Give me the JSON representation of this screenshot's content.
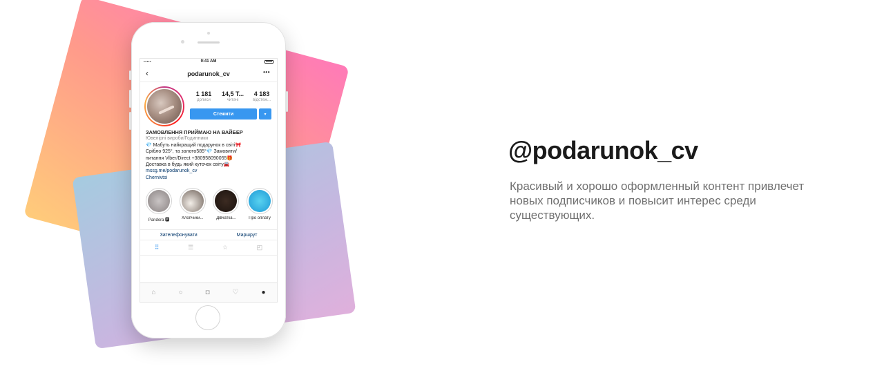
{
  "phone": {
    "status_bar": {
      "signal": "•••••",
      "time": "9:41 AM"
    },
    "nav": {
      "back_icon": "‹",
      "username": "podarunok_cv",
      "more_icon": "•••"
    },
    "stats": [
      {
        "value": "1 181",
        "label": "дописи"
      },
      {
        "value": "14,5 Т...",
        "label": "читачі"
      },
      {
        "value": "4 183",
        "label": "відстеж..."
      }
    ],
    "follow_label": "Стежити",
    "dropdown_icon": "▾",
    "bio": {
      "name": "ЗАМОВЛЕННЯ ПРИЙМАЮ НА ВАЙБЕР",
      "category": "Ювелірні вироби/Годинники",
      "lines": [
        "💎 Мабуть найкращий подарунок в світі🎀",
        "Срібло 925°, та золото585°💎 Замовити/",
        "питання Viber/Direct +380958090055🎁",
        "Доставка в будь який куточок світу🚘"
      ],
      "link": "mssg.me/podarunok_cv",
      "location": "Chernivtsi"
    },
    "highlights": [
      {
        "label": "Pandora 🅿"
      },
      {
        "label": "Хлопчики..."
      },
      {
        "label": "Дівчатка..."
      },
      {
        "label": "Про оплату"
      }
    ],
    "contact": {
      "call": "Зателефонувати",
      "route": "Маршрут"
    },
    "view_tabs": {
      "grid": "⠿",
      "list": "☰",
      "tagged": "☆",
      "profile": "◰"
    },
    "bottom_nav": {
      "home": "⌂",
      "search": "○",
      "camera": "◘",
      "heart": "♡",
      "profile": "●"
    }
  },
  "headline": "@podarunok_cv",
  "description": "Красивый и хорошо оформленный контент привлечет новых подписчиков и повысит интерес среди существующих.",
  "colors": {
    "accent": "#3897f0",
    "link": "#003569",
    "card_pink": "#ff7ab8",
    "card_blue": "#a5cbe0",
    "headline": "#1a1a1a",
    "description": "#707070"
  }
}
